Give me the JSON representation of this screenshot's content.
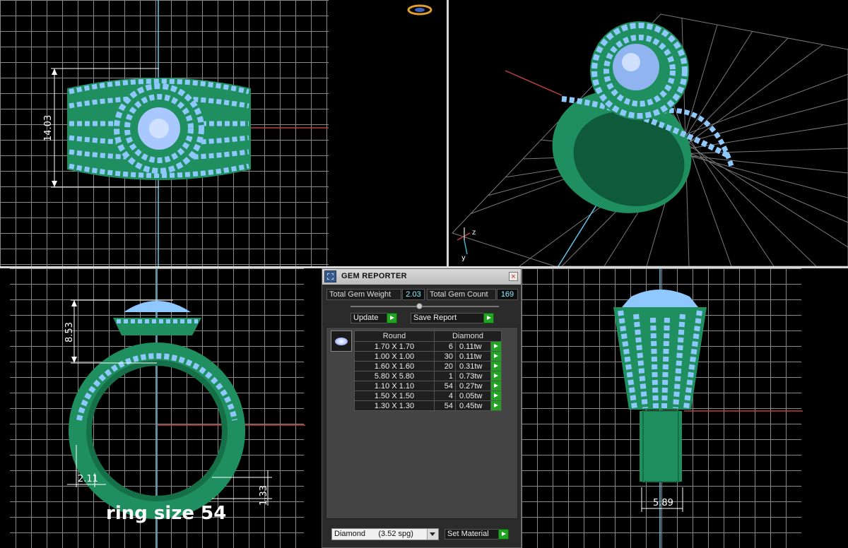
{
  "dimensions": {
    "top_height": "14.03",
    "front_head_height": "8.53",
    "shank_width": "2.11",
    "shank_thickness": "1.33",
    "side_width": "5.89"
  },
  "caption": "ring size 54",
  "axis_labels": {
    "z": "z",
    "y": "y"
  },
  "gem_reporter": {
    "title": "GEM REPORTER",
    "close_icon": "close-icon",
    "total_weight_label": "Total Gem Weight",
    "total_weight_value": "2.03",
    "total_count_label": "Total Gem Count",
    "total_count_value": "169",
    "update_label": "Update",
    "save_report_label": "Save Report",
    "table": {
      "headers": [
        "Round",
        "Diamond"
      ],
      "rows": [
        {
          "size": "1.70 X 1.70",
          "count": "6",
          "weight": "0.11tw"
        },
        {
          "size": "1.00 X 1.00",
          "count": "30",
          "weight": "0.11tw"
        },
        {
          "size": "1.60 X 1.60",
          "count": "20",
          "weight": "0.31tw"
        },
        {
          "size": "5.80 X 5.80",
          "count": "1",
          "weight": "0.73tw"
        },
        {
          "size": "1.10 X 1.10",
          "count": "54",
          "weight": "0.27tw"
        },
        {
          "size": "1.50 X 1.50",
          "count": "4",
          "weight": "0.05tw"
        },
        {
          "size": "1.30 X 1.30",
          "count": "54",
          "weight": "0.45tw"
        }
      ]
    },
    "material_select": "Diamond      (3.52 spg)",
    "set_material_label": "Set Material"
  },
  "colors": {
    "metal": "#1f8f5f",
    "gem": "#8fc8ff",
    "grid": "#8a8a8a",
    "go": "#23a323"
  }
}
